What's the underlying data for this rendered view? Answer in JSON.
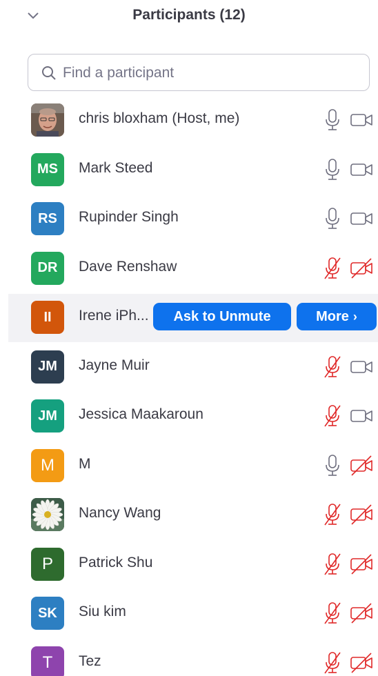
{
  "header": {
    "title": "Participants (12)"
  },
  "search": {
    "placeholder": "Find a participant",
    "value": ""
  },
  "hover_actions": {
    "ask_to_unmute": "Ask to Unmute",
    "more": "More",
    "more_chevron": "›"
  },
  "colors": {
    "accent": "#0e72ed",
    "muted_red": "#e02828",
    "icon_gray": "#6e6e7e"
  },
  "participants": [
    {
      "name": "chris bloxham (Host, me)",
      "initials": "",
      "avatar": "photo-man",
      "avatar_color": "#a08070",
      "mic": "on",
      "video": "off"
    },
    {
      "name": "Mark Steed",
      "initials": "MS",
      "avatar_color": "#23a85d",
      "mic": "on",
      "video": "off"
    },
    {
      "name": "Rupinder Singh",
      "initials": "RS",
      "avatar_color": "#2d7fc2",
      "mic": "on",
      "video": "off"
    },
    {
      "name": "Dave Renshaw",
      "initials": "DR",
      "avatar_color": "#23a85d",
      "mic": "muted",
      "video": "disabled"
    },
    {
      "name": "Irene iPh...",
      "initials": "II",
      "avatar_color": "#d2560b",
      "mic": "",
      "video": ""
    },
    {
      "name": "Jayne Muir",
      "initials": "JM",
      "avatar_color": "#2d3e50",
      "mic": "muted",
      "video": "off"
    },
    {
      "name": "Jessica Maakaroun",
      "initials": "JM",
      "avatar_color": "#15a07f",
      "mic": "muted",
      "video": "off"
    },
    {
      "name": "M",
      "initials": "M",
      "avatar_color": "#f39b14",
      "mic": "on",
      "video": "disabled"
    },
    {
      "name": "Nancy Wang",
      "initials": "",
      "avatar": "photo-daisy",
      "avatar_color": "#4a6a55",
      "mic": "muted",
      "video": "disabled"
    },
    {
      "name": "Patrick Shu",
      "initials": "P",
      "avatar_color": "#2e6b2e",
      "mic": "muted",
      "video": "disabled"
    },
    {
      "name": "Siu kim",
      "initials": "SK",
      "avatar_color": "#2d7fc2",
      "mic": "muted",
      "video": "disabled"
    },
    {
      "name": "Tez",
      "initials": "T",
      "avatar_color": "#8e44ad",
      "mic": "muted",
      "video": "disabled"
    }
  ]
}
